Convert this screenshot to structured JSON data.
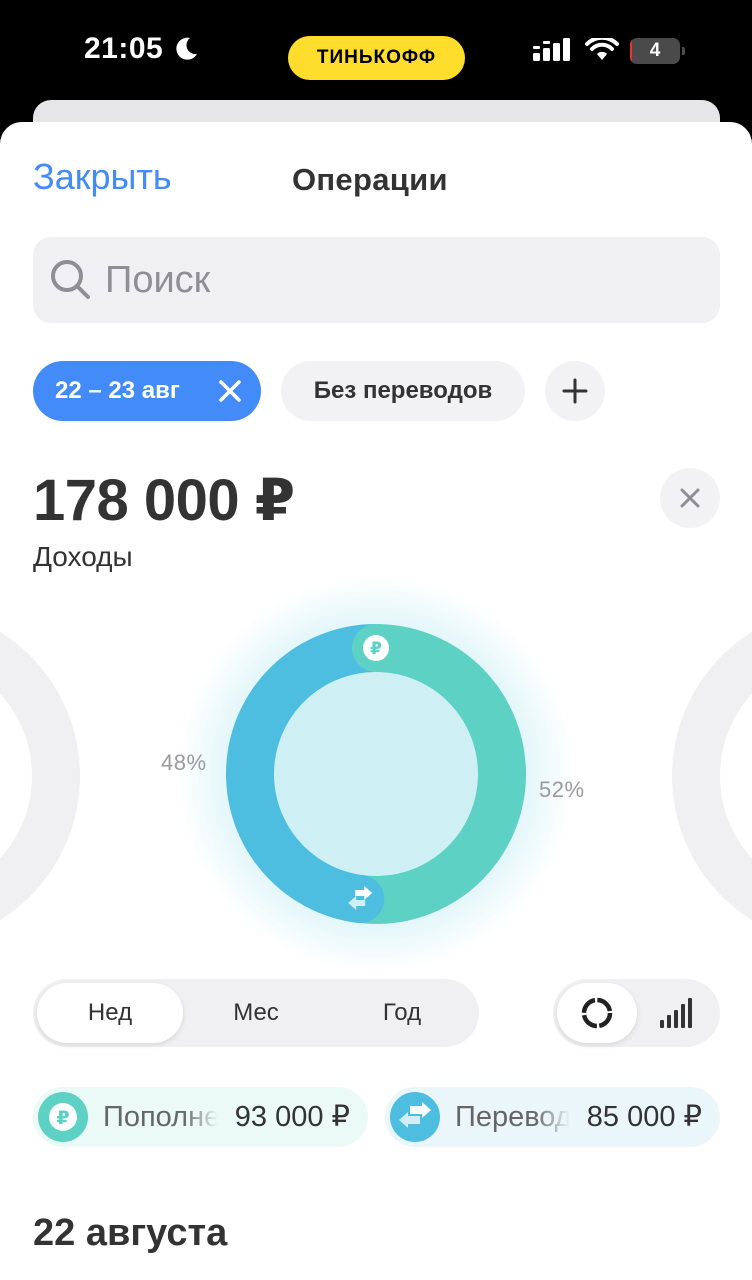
{
  "status_bar": {
    "time": "21:05",
    "carrier": "ТИНЬКОФФ",
    "battery_level": "4",
    "battery_fraction": 0.04,
    "accent": "#ffdd2d"
  },
  "header": {
    "close_label": "Закрыть",
    "title": "Операции"
  },
  "search": {
    "placeholder": "Поиск",
    "value": ""
  },
  "filters": {
    "date_chip": "22 – 23 авг",
    "transfers_chip": "Без переводов"
  },
  "summary": {
    "amount": "178 000 ₽",
    "label": "Доходы"
  },
  "chart_data": {
    "type": "pie",
    "slices": [
      {
        "name": "Пополнения",
        "percent": 52,
        "label": "52%",
        "color": "#5cd1c4",
        "icon": "ruble-icon"
      },
      {
        "name": "Переводы",
        "percent": 48,
        "label": "48%",
        "color": "#4dbde0",
        "icon": "transfer-icon"
      }
    ]
  },
  "period": {
    "options": [
      "Нед",
      "Мес",
      "Год"
    ],
    "selected": "Нед"
  },
  "view_mode": {
    "options": [
      "ring-chart-icon",
      "bar-chart-icon"
    ],
    "selected": "ring-chart-icon"
  },
  "categories": [
    {
      "name": "Пополнения",
      "amount": "93 000 ₽",
      "icon": "ruble-icon",
      "color": "#5cd1c4"
    },
    {
      "name": "Переводы",
      "amount": "85 000 ₽",
      "icon": "transfer-icon",
      "color": "#4dbde0"
    }
  ],
  "list": {
    "section_date": "22 августа"
  }
}
